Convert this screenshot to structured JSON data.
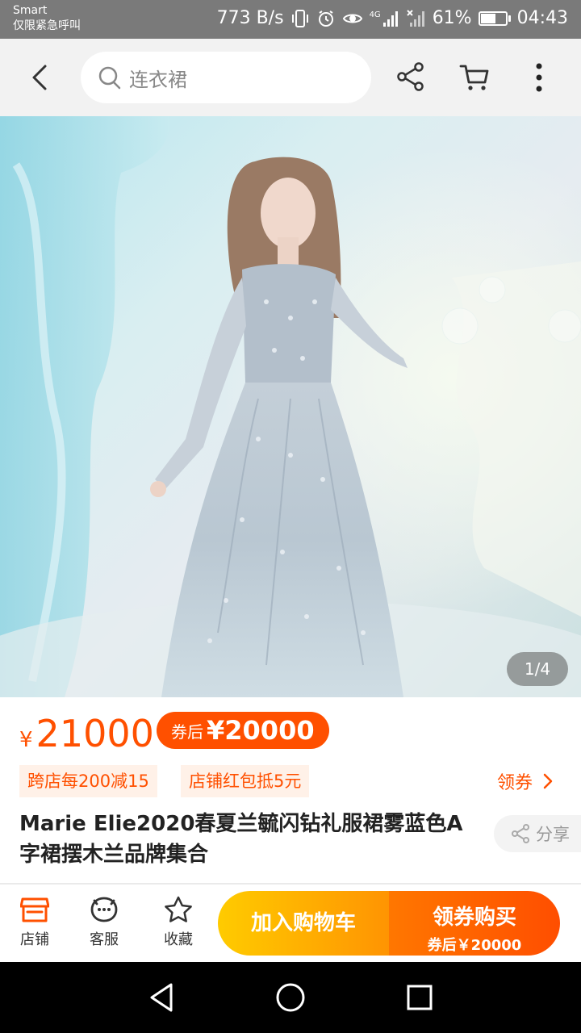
{
  "status_bar": {
    "carrier": "Smart",
    "emergency": "仅限紧急呼叫",
    "net_speed": "773 B/s",
    "network": "4G",
    "battery": "61%",
    "battery_level": 0.61,
    "time": "04:43"
  },
  "top_nav": {
    "search_text": "连衣裙"
  },
  "image_counter": "1/4",
  "price": {
    "currency": "¥",
    "amount": "21000",
    "coupon_label": "券后",
    "coupon_price": "¥20000"
  },
  "promos": [
    "跨店每200减15",
    "店铺红包抵5元"
  ],
  "get_coupon": "领券",
  "product_title": "Marie Elie2020春夏兰毓闪钻礼服裙雾蓝色A字裙摆木兰品牌集合",
  "share_label": "分享",
  "bottom_bar": {
    "shop": "店铺",
    "service": "客服",
    "favorite": "收藏",
    "add_to_cart": "加入购物车",
    "buy_main": "领券购买",
    "buy_sub": "券后￥20000"
  },
  "colors": {
    "accent": "#ff5000",
    "cart_button": "#ffb000",
    "buy_button": "#ff5a00"
  }
}
